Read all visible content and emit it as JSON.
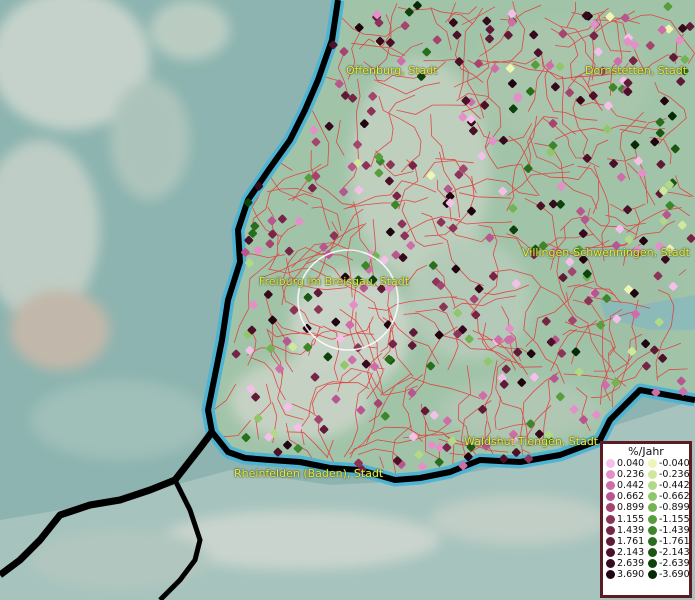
{
  "map": {
    "cities": [
      {
        "name": "Offenburg, Stadt"
      },
      {
        "name": "Dornstetten, Stadt"
      },
      {
        "name": "Villingen-Schwenningen, Stadt"
      },
      {
        "name": "Freiburg im Breisgau, Stadt"
      },
      {
        "name": "Waldshut-Tiengen, Stadt"
      },
      {
        "name": "Rheinfelden (Baden), Stadt"
      }
    ],
    "colors": {
      "land": "#9cbfa8",
      "water": "#57b7d0",
      "boundary": "#e23b3b",
      "border": "#000000",
      "label": "#e8ec3a"
    }
  },
  "legend": {
    "title": "%/Jahr",
    "positive": [
      {
        "value": "0.040",
        "color": "#f4bfe8"
      },
      {
        "value": "0.236",
        "color": "#e48fc9"
      },
      {
        "value": "0.442",
        "color": "#cf6da8"
      },
      {
        "value": "0.662",
        "color": "#b85690"
      },
      {
        "value": "0.899",
        "color": "#a4446f"
      },
      {
        "value": "1.155",
        "color": "#8c3358"
      },
      {
        "value": "1.439",
        "color": "#762546"
      },
      {
        "value": "1.761",
        "color": "#601936"
      },
      {
        "value": "2.143",
        "color": "#4c1029"
      },
      {
        "value": "2.639",
        "color": "#37091c"
      },
      {
        "value": "3.690",
        "color": "#200410"
      }
    ],
    "negative": [
      {
        "value": "-0.040",
        "color": "#eef6b6"
      },
      {
        "value": "-0.236",
        "color": "#cfe89c"
      },
      {
        "value": "-0.442",
        "color": "#b2da86"
      },
      {
        "value": "-0.662",
        "color": "#92c66a"
      },
      {
        "value": "-0.899",
        "color": "#74b353"
      },
      {
        "value": "-1.155",
        "color": "#579e3d"
      },
      {
        "value": "-1.439",
        "color": "#3d872a"
      },
      {
        "value": "-1.761",
        "color": "#286f1d"
      },
      {
        "value": "-2.143",
        "color": "#195813"
      },
      {
        "value": "-2.639",
        "color": "#0e420c"
      },
      {
        "value": "-3.690",
        "color": "#062a06"
      }
    ]
  }
}
